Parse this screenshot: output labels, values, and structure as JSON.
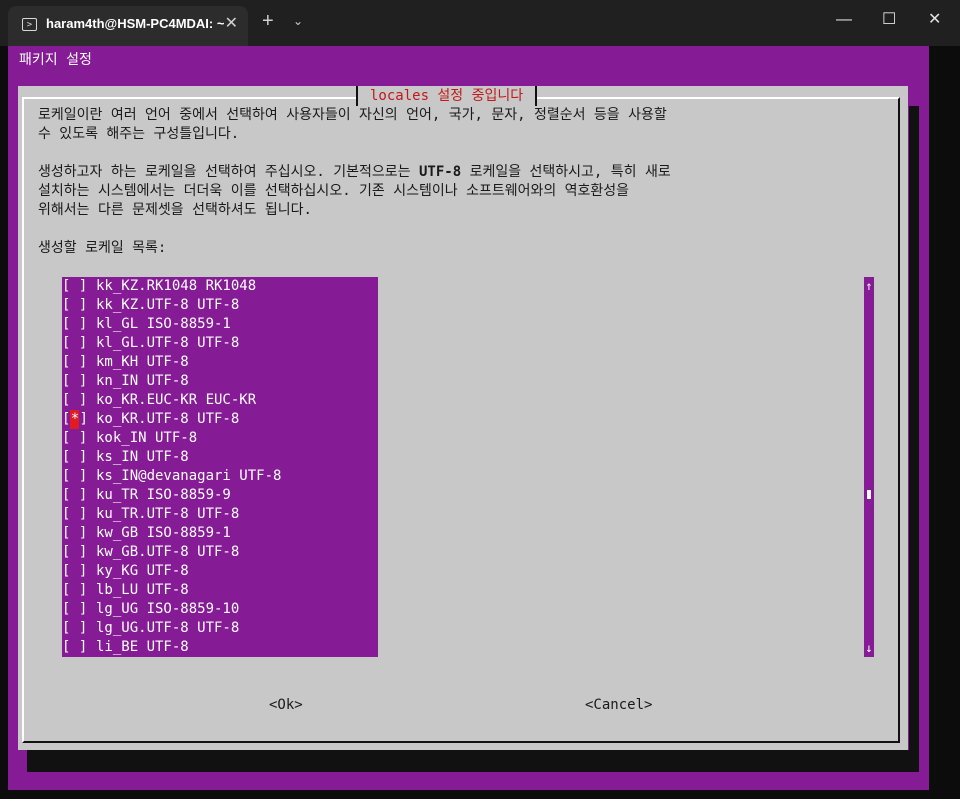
{
  "window": {
    "tab_title": "haram4th@HSM-PC4MDAI: ~",
    "tab_icon": "terminal-icon",
    "close_tab": "✕",
    "new_tab": "+",
    "dropdown": "⌄",
    "minimize": "—",
    "maximize": "☐",
    "close": "✕"
  },
  "backtitle": "패키지 설정",
  "dialog": {
    "title": "locales 설정 중입니다",
    "paragraph1": [
      "로케일이란 여러 언어 중에서 선택하여 사용자들이 자신의 언어, 국가, 문자, 정렬순서 등을 사용할",
      "수 있도록 해주는 구성틀입니다."
    ],
    "paragraph2": {
      "line1_pre": "생성하고자 하는 로케일을 선택하여 주십시오. 기본적으로는 ",
      "line1_bold": "UTF-8",
      "line1_post": " 로케일을 선택하시고, 특히 새로",
      "line2": "설치하는 시스템에서는 더더욱 이를 선택하십시오. 기존 시스템이나 소프트웨어와의 역호환성을",
      "line3": "위해서는 다른 문제셋을 선택하셔도 됩니다."
    },
    "list_label": "생성할 로케일 목록:",
    "locales": [
      {
        "checked": false,
        "label": "kk_KZ.RK1048 RK1048"
      },
      {
        "checked": false,
        "label": "kk_KZ.UTF-8 UTF-8"
      },
      {
        "checked": false,
        "label": "kl_GL ISO-8859-1"
      },
      {
        "checked": false,
        "label": "kl_GL.UTF-8 UTF-8"
      },
      {
        "checked": false,
        "label": "km_KH UTF-8"
      },
      {
        "checked": false,
        "label": "kn_IN UTF-8"
      },
      {
        "checked": false,
        "label": "ko_KR.EUC-KR EUC-KR"
      },
      {
        "checked": true,
        "label": "ko_KR.UTF-8 UTF-8"
      },
      {
        "checked": false,
        "label": "kok_IN UTF-8"
      },
      {
        "checked": false,
        "label": "ks_IN UTF-8"
      },
      {
        "checked": false,
        "label": "ks_IN@devanagari UTF-8"
      },
      {
        "checked": false,
        "label": "ku_TR ISO-8859-9"
      },
      {
        "checked": false,
        "label": "ku_TR.UTF-8 UTF-8"
      },
      {
        "checked": false,
        "label": "kw_GB ISO-8859-1"
      },
      {
        "checked": false,
        "label": "kw_GB.UTF-8 UTF-8"
      },
      {
        "checked": false,
        "label": "ky_KG UTF-8"
      },
      {
        "checked": false,
        "label": "lb_LU UTF-8"
      },
      {
        "checked": false,
        "label": "lg_UG ISO-8859-10"
      },
      {
        "checked": false,
        "label": "lg_UG.UTF-8 UTF-8"
      },
      {
        "checked": false,
        "label": "li_BE UTF-8"
      }
    ],
    "scroll_up": "↑",
    "scroll_down": "↓",
    "ok_label": "<Ok>",
    "cancel_label": "<Cancel>"
  },
  "colors": {
    "background": "#861b96",
    "dialog": "#c8c8c8",
    "title_text": "#c41818",
    "checked_mark": "#e01b24"
  }
}
